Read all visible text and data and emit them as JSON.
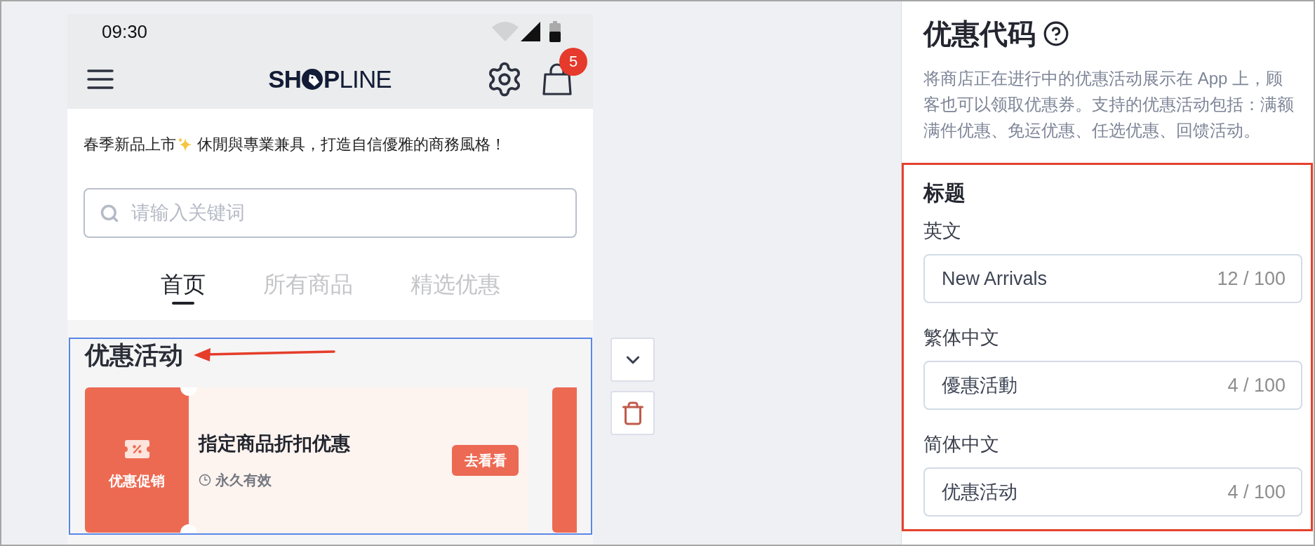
{
  "preview": {
    "status_bar": {
      "time": "09:30"
    },
    "header": {
      "logo": {
        "start": "SH",
        "end": "**P**LINE"
      },
      "cart_count": "5"
    },
    "announcement": {
      "before_icon": "春季新品上市",
      "after_icon": "休閒與專業兼具，打造自信優雅的商務風格！"
    },
    "search": {
      "placeholder": "请输入关键词"
    },
    "tabs": [
      {
        "label": "首页",
        "selected": true
      },
      {
        "label": "所有商品",
        "selected": false
      },
      {
        "label": "精选优惠",
        "selected": false
      }
    ],
    "promotion_block": {
      "selected": true,
      "title": "优惠活动",
      "coupons": [
        {
          "kind": "full",
          "badge": "优惠促销",
          "name": "指定商品折扣优惠",
          "validity": "永久有效",
          "action": "去看看"
        },
        {
          "kind": "edge"
        }
      ]
    }
  },
  "settings": {
    "title": "优惠代码",
    "description": "将商店正在进行中的优惠活动展示在 App 上，顾客也可以领取优惠券。支持的优惠活动包括：满额满件优惠、免运优惠、任选优惠、回馈活动。",
    "section": {
      "highlighted": true,
      "title": "标题",
      "fields": [
        {
          "label": "英文",
          "value": "New Arrivals",
          "counter": "12 / 100"
        },
        {
          "label": "繁体中文",
          "value": "優惠活動",
          "counter": "4 / 100"
        },
        {
          "label": "简体中文",
          "value": "优惠活动",
          "counter": "4 / 100"
        }
      ]
    }
  }
}
